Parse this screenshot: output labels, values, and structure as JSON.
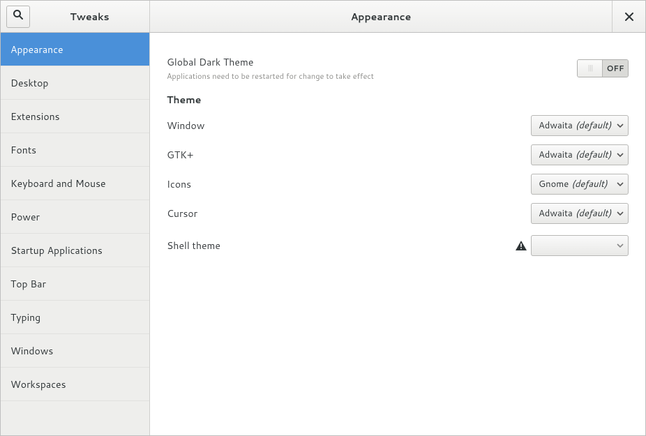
{
  "header": {
    "app_title": "Tweaks",
    "page_title": "Appearance"
  },
  "sidebar": {
    "items": [
      {
        "id": "appearance",
        "label": "Appearance",
        "active": true
      },
      {
        "id": "desktop",
        "label": "Desktop",
        "active": false
      },
      {
        "id": "extensions",
        "label": "Extensions",
        "active": false
      },
      {
        "id": "fonts",
        "label": "Fonts",
        "active": false
      },
      {
        "id": "keyboard-mouse",
        "label": "Keyboard and Mouse",
        "active": false
      },
      {
        "id": "power",
        "label": "Power",
        "active": false
      },
      {
        "id": "startup-apps",
        "label": "Startup Applications",
        "active": false
      },
      {
        "id": "top-bar",
        "label": "Top Bar",
        "active": false
      },
      {
        "id": "typing",
        "label": "Typing",
        "active": false
      },
      {
        "id": "windows",
        "label": "Windows",
        "active": false
      },
      {
        "id": "workspaces",
        "label": "Workspaces",
        "active": false
      }
    ]
  },
  "content": {
    "global_dark": {
      "label": "Global Dark Theme",
      "desc": "Applications need to be restarted for change to take effect",
      "switch_state": "OFF",
      "switch_on": false
    },
    "theme_section_label": "Theme",
    "rows": {
      "window": {
        "label": "Window",
        "value": "Adwaita",
        "suffix": "(default)"
      },
      "gtk": {
        "label": "GTK+",
        "value": "Adwaita",
        "suffix": "(default)"
      },
      "icons": {
        "label": "Icons",
        "value": "Gnome",
        "suffix": "(default)"
      },
      "cursor": {
        "label": "Cursor",
        "value": "Adwaita",
        "suffix": "(default)"
      },
      "shell": {
        "label": "Shell theme",
        "value": "",
        "suffix": "",
        "warning": true
      }
    }
  }
}
